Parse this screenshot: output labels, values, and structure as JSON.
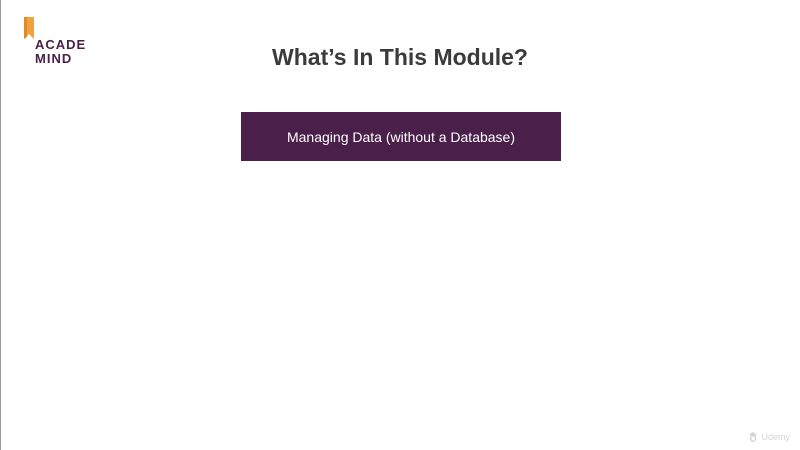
{
  "logo": {
    "line1": "ACADE",
    "line2": "MIND",
    "accent_color": "#f0a240",
    "text_color": "#4a1f4a"
  },
  "slide": {
    "title": "What’s In This Module?",
    "topics": [
      "Managing Data (without a Database)"
    ],
    "topic_bg_color": "#4a1f4a"
  },
  "watermark": {
    "icon": "udemy-icon",
    "label": "Udemy"
  }
}
